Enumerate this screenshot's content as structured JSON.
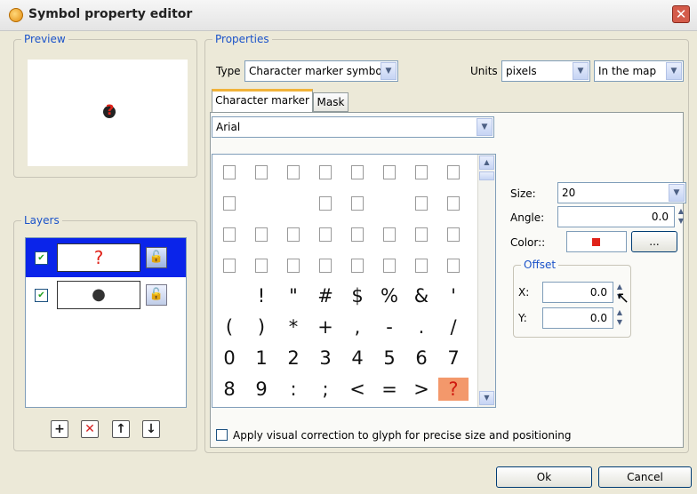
{
  "window": {
    "title": "Symbol property editor",
    "close_glyph": "✕"
  },
  "preview": {
    "label": "Preview"
  },
  "layers": {
    "label": "Layers",
    "rows": [
      {
        "checked": "✔",
        "glyph": "?",
        "glyph_color": "#e0231a",
        "selected": true
      },
      {
        "checked": "✔",
        "glyph": "●",
        "glyph_color": "#333333",
        "selected": false
      }
    ],
    "buttons": [
      {
        "name": "add-layer-button",
        "glyph": "+"
      },
      {
        "name": "remove-layer-button",
        "glyph": "✕"
      },
      {
        "name": "move-layer-up-button",
        "glyph": "↑"
      },
      {
        "name": "move-layer-down-button",
        "glyph": "↓"
      }
    ]
  },
  "properties": {
    "label": "Properties",
    "type_label": "Type",
    "type_value": "Character marker symbol",
    "units_label": "Units",
    "units_value": "pixels",
    "units_scope": "In the map",
    "tabs": [
      "Character marker",
      "Mask"
    ],
    "font_value": "Arial",
    "glyph_rows": [
      [
        "□",
        "□",
        "□",
        "□",
        "□",
        "□",
        "□",
        "□"
      ],
      [
        "□",
        "",
        "",
        "□",
        "□",
        "",
        "□",
        "□"
      ],
      [
        "□",
        "□",
        "□",
        "□",
        "□",
        "□",
        "□",
        "□"
      ],
      [
        "□",
        "□",
        "□",
        "□",
        "□",
        "□",
        "□",
        "□"
      ],
      [
        "",
        "!",
        "\"",
        "#",
        "$",
        "%",
        "&",
        "'"
      ],
      [
        "(",
        ")",
        "*",
        "+",
        ",",
        "-",
        ".",
        "/"
      ],
      [
        "0",
        "1",
        "2",
        "3",
        "4",
        "5",
        "6",
        "7"
      ],
      [
        "8",
        "9",
        ":",
        ";",
        "<",
        "=",
        ">",
        "?"
      ]
    ],
    "selected_glyph": "?",
    "size_label": "Size:",
    "size_value": "20",
    "angle_label": "Angle:",
    "angle_value": "0.0",
    "color_label": "Color::",
    "color_swatch": "#e0231a",
    "color_button": "...",
    "offset_label": "Offset",
    "x_label": "X:",
    "x_value": "0.0",
    "y_label": "Y:",
    "y_value": "0.0",
    "correction_label": "Apply visual correction to glyph for precise size and positioning"
  },
  "footer": {
    "ok_label": "Ok",
    "cancel_label": "Cancel"
  },
  "colors": {
    "group_label": "#1b53c9",
    "selection": "#0a24ea",
    "selected_glyph_bg": "#f3986b"
  }
}
